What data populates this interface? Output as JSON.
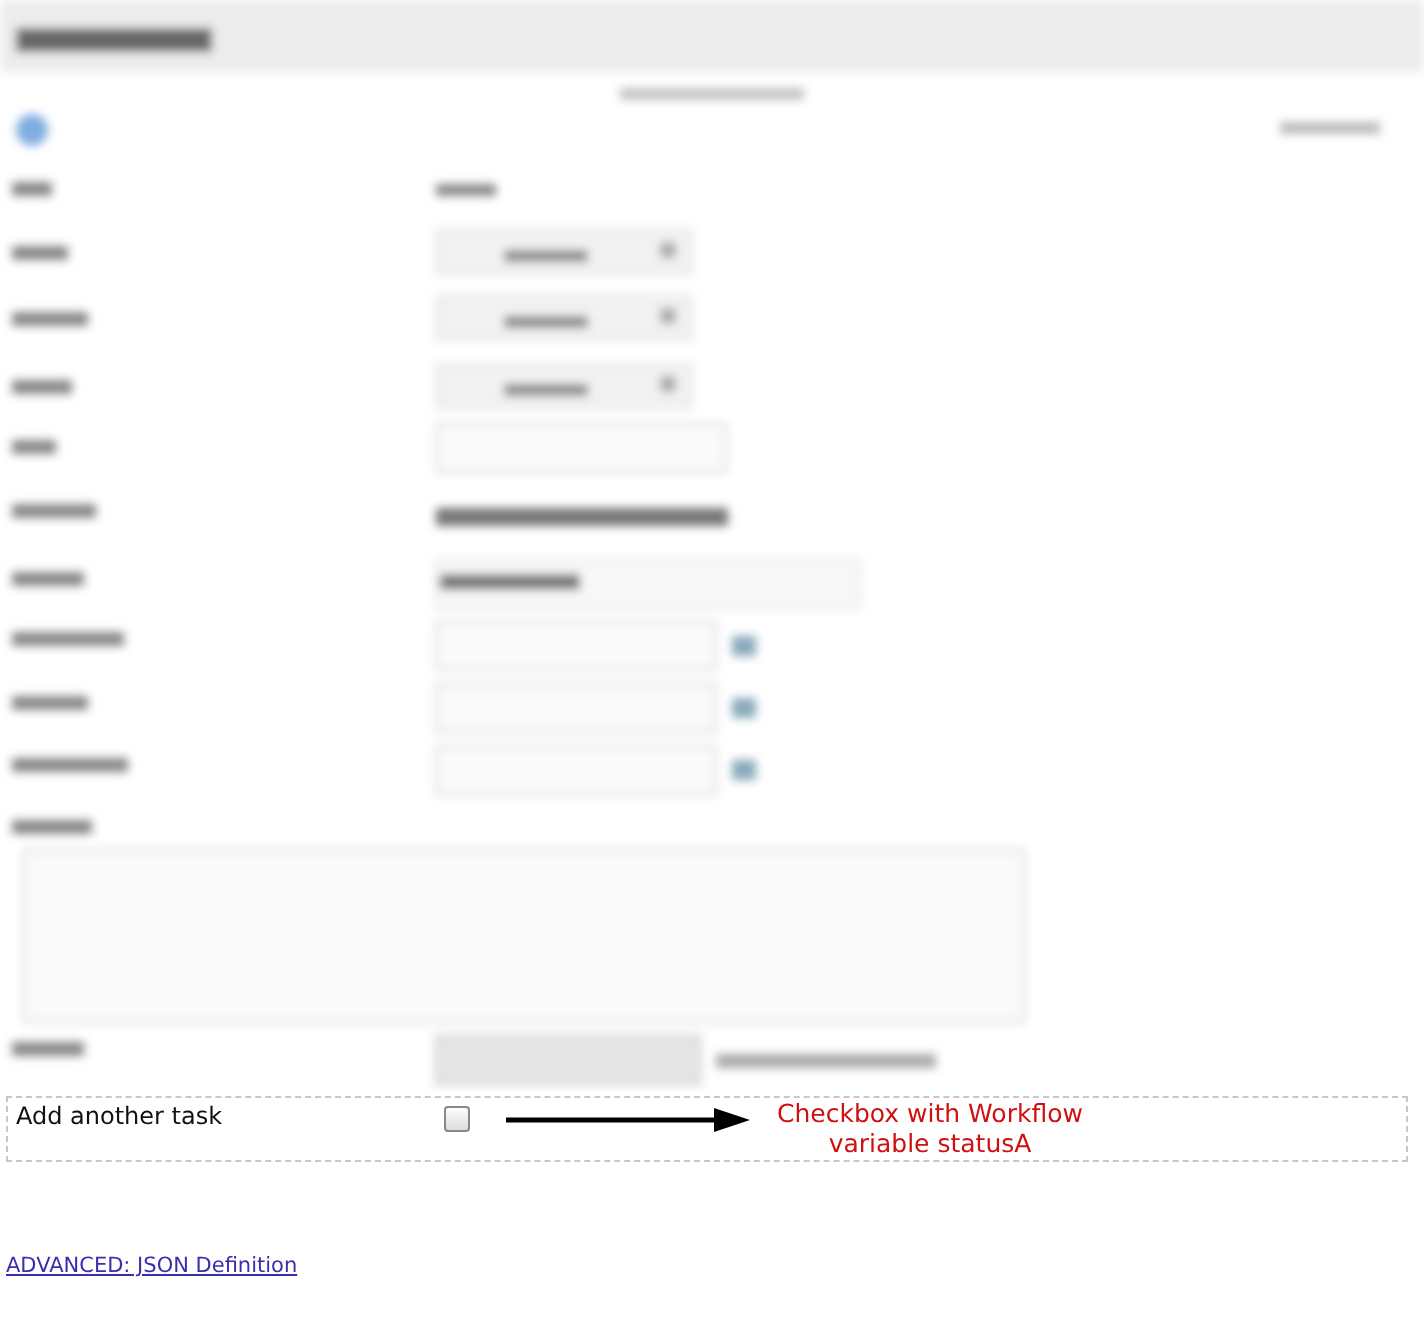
{
  "task_row": {
    "label": "Add another task",
    "checkbox": {
      "checked": false
    }
  },
  "annotation": {
    "text": "Checkbox with Workflow variable statusA"
  },
  "link": "ADVANCED: JSON Definition"
}
